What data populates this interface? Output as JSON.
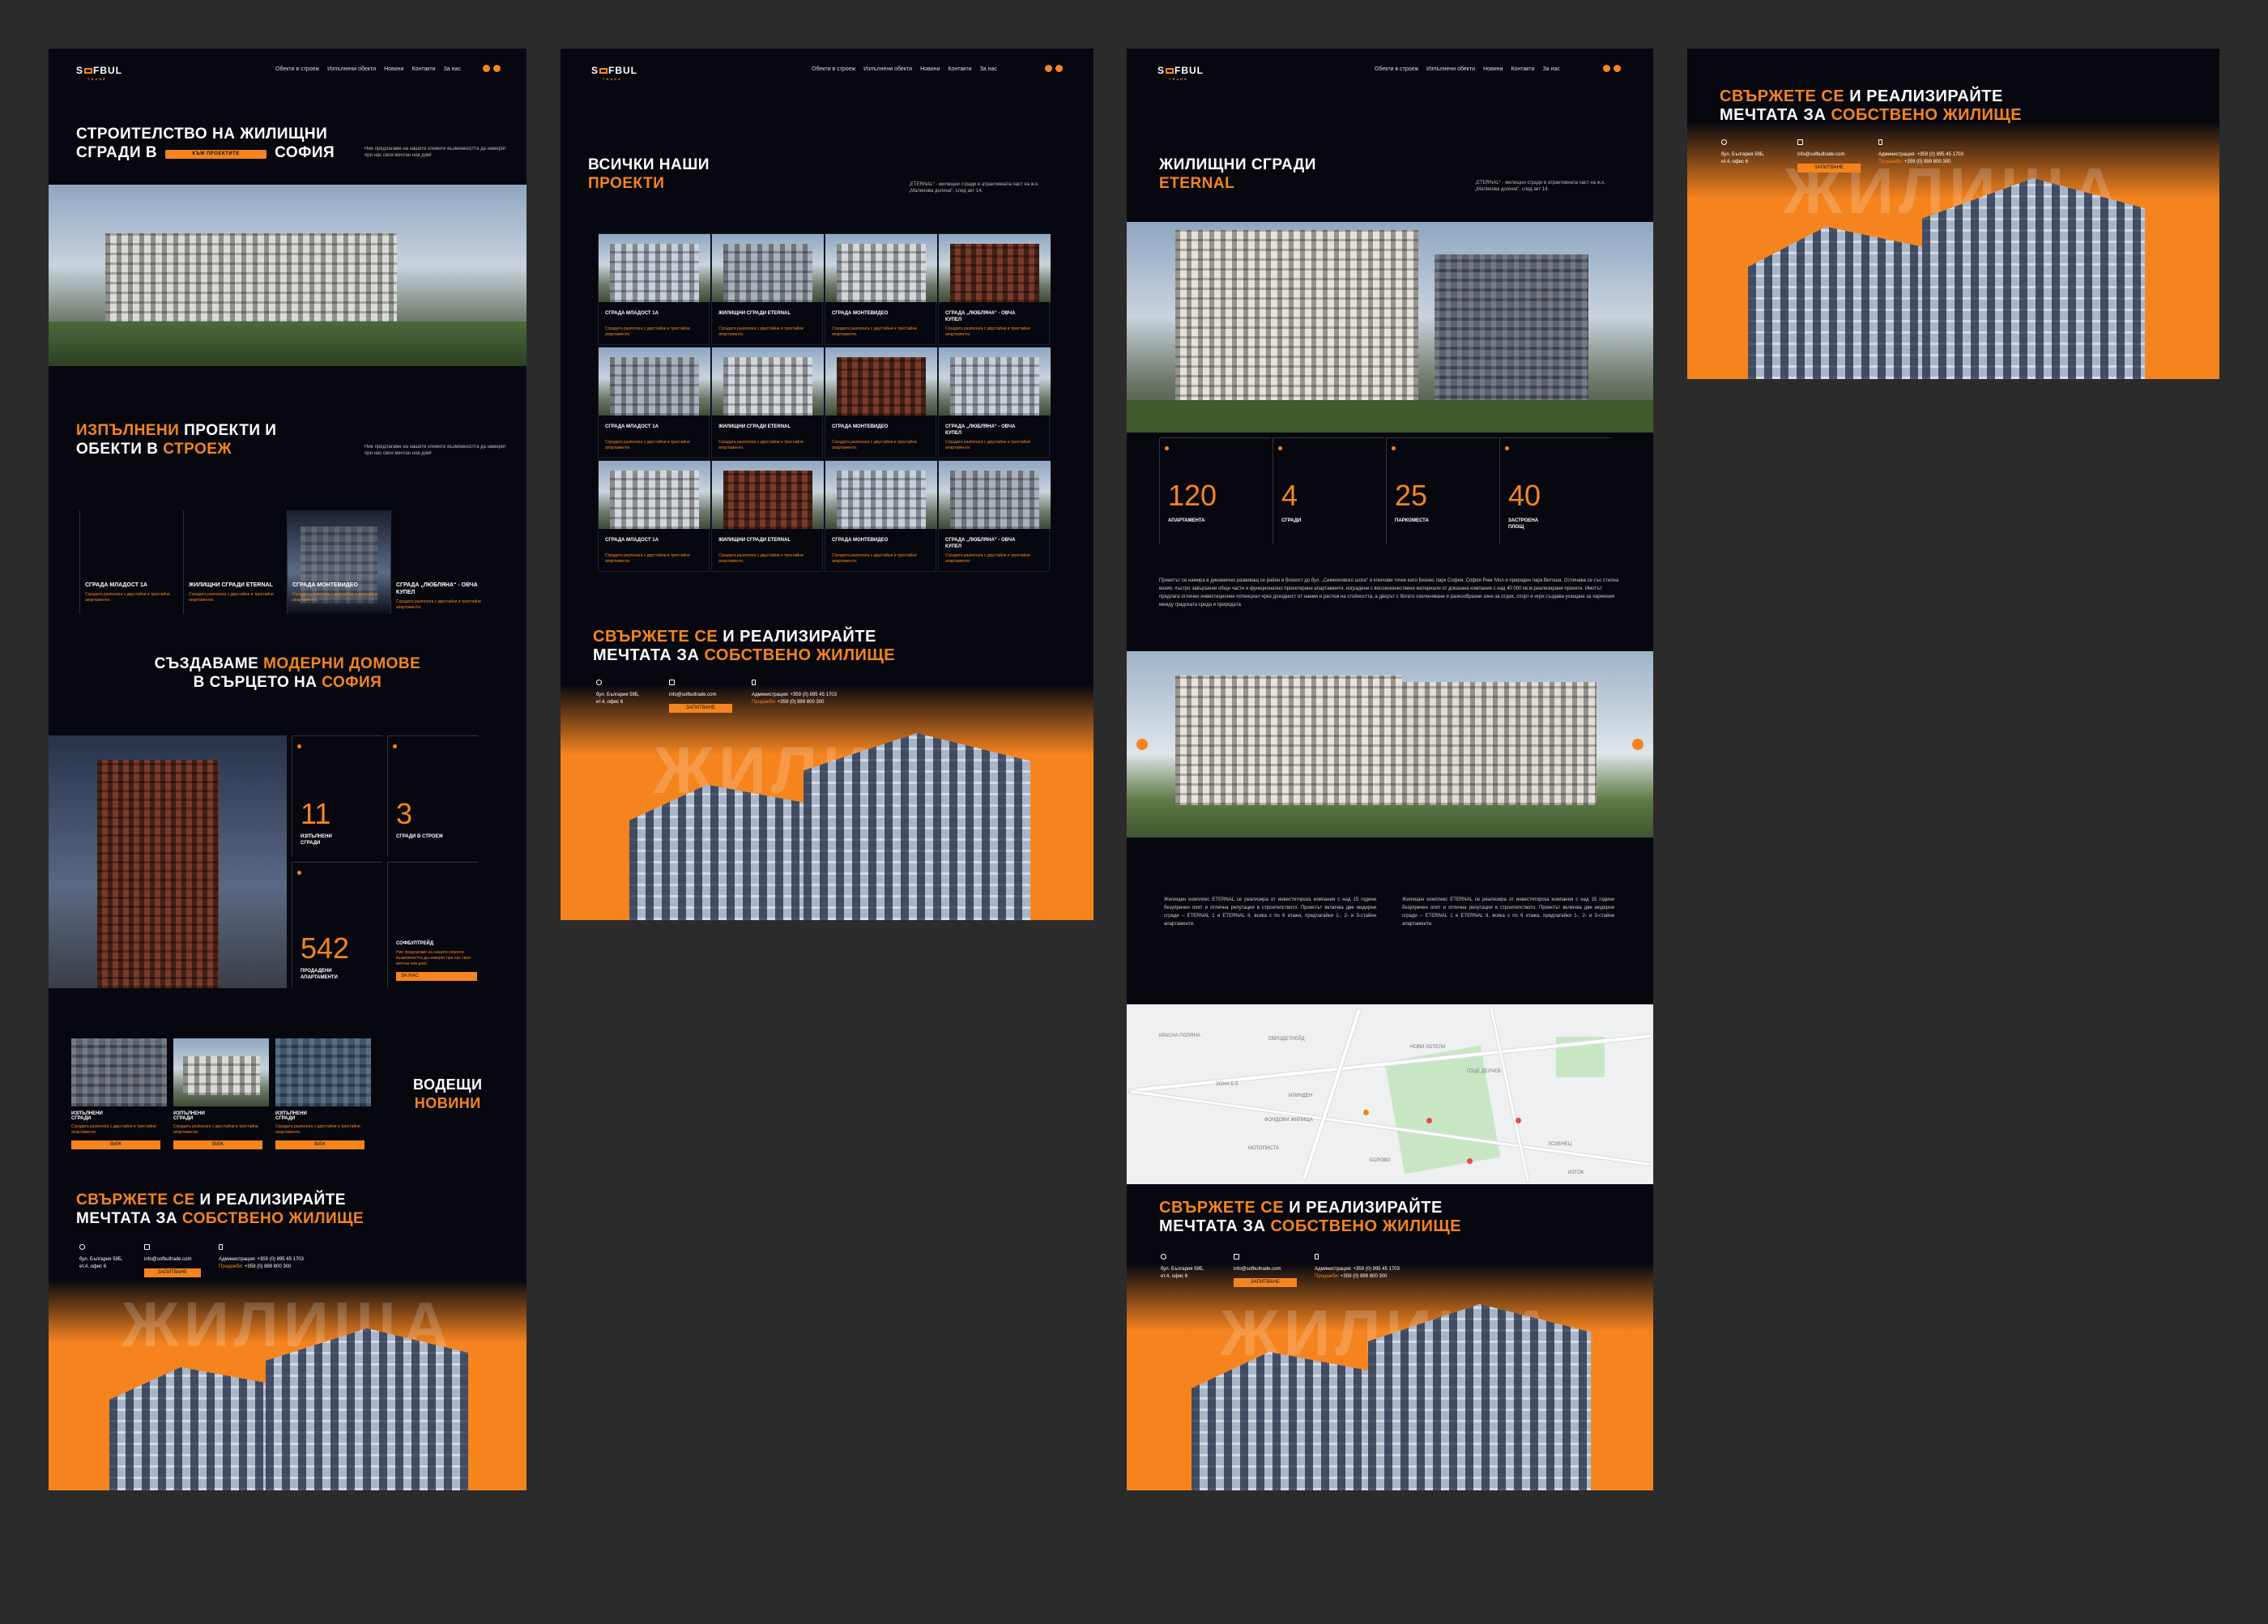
{
  "brand": {
    "name_a": "S",
    "name_b": "FBUL",
    "sub": "TRADE"
  },
  "nav": [
    "Обекти в строеж",
    "Изпълнени обекти",
    "Новини",
    "Контакти",
    "За нас"
  ],
  "home": {
    "hero_title_1": "СТРОИТЕЛСТВО НА ЖИЛИЩНИ",
    "hero_title_2a": "СГРАДИ В",
    "hero_title_2b": "СОФИЯ",
    "hero_btn": "КЪМ ПРОЕКТИТЕ",
    "hero_desc": "Ние предлагаме на нашите клиенти възможността да намерят при нас своя мечтан нов дом!",
    "sec2_a": "ИЗПЪЛНЕНИ",
    "sec2_b": "ПРОЕКТИ И",
    "sec2_c": "ОБЕКТИ В",
    "sec2_d": "СТРОЕЖ",
    "sec2_desc": "Ние предлагаме на нашите клиенти възможността да намерят при нас своя мечтан нов дом!",
    "cards": [
      {
        "title": "СГРАДА МЛАДОСТ 1А",
        "desc": "Сградата разполага с двустайни и тристайни апартаменти."
      },
      {
        "title": "ЖИЛИЩНИ СГРАДИ ETERNAL",
        "desc": "Сградата разполага с двустайни и тристайни апартаменти."
      },
      {
        "title": "СГРАДА МОНТЕВИДЕО",
        "desc": "Сградата разполага с двустайни и тристайни апартаменти."
      },
      {
        "title": "СГРАДА „ЛЮБЛЯНА“ - ОВЧА КУПЕЛ",
        "desc": "Сградата разполага с двустайни и тристайни апартаменти."
      }
    ],
    "sec3_a": "СЪЗДАВАМЕ",
    "sec3_b": "МОДЕРНИ ДОМОВЕ",
    "sec3_c": "В СЪРЦЕТО НА",
    "sec3_d": "СОФИЯ",
    "stats": [
      {
        "n": "11",
        "l": "ИЗПЪЛНЕНИ СГРАДИ"
      },
      {
        "n": "3",
        "l": "СГРАДИ В СТРОЕЖ"
      },
      {
        "n": "542",
        "l": "ПРОДАДЕНИ АПАРТАМЕНТИ"
      }
    ],
    "sofia_title": "СОФБУЛТРЕЙД",
    "sofia_desc": "Ние предлагаме на нашите клиенти възможността да намерят при нас своя мечтан нов дом!",
    "sofia_btn": "ЗА НАС",
    "news": [
      {
        "title": "ИЗПЪЛНЕНИ СГРАДИ",
        "desc": "Сградата разполага с двустайни и тристайни апартаменти.",
        "btn": "ВИЖ"
      },
      {
        "title": "ИЗПЪЛНЕНИ СГРАДИ",
        "desc": "Сградата разполага с двустайни и тристайни апартаменти.",
        "btn": "ВИЖ"
      },
      {
        "title": "ИЗПЪЛНЕНИ СГРАДИ",
        "desc": "Сградата разполага с двустайни и тристайни апартаменти.",
        "btn": "ВИЖ"
      }
    ],
    "news_a": "ВОДЕЩИ",
    "news_b": "НОВИНИ"
  },
  "projects": {
    "title_a": "ВСИЧКИ НАШИ",
    "title_b": "ПРОЕКТИ",
    "desc": "„ETERNAL“ - жилищни сгради в атрактивната част на ж.к. „Малинова долина“, след акт 14.",
    "grid": [
      {
        "title": "СГРАДА МЛАДОСТ 1А",
        "desc": "Сградата разполага с двустайни и тристайни апартаменти."
      },
      {
        "title": "ЖИЛИЩНИ СГРАДИ ETERNAL",
        "desc": "Сградата разполага с двустайни и тристайни апартаменти."
      },
      {
        "title": "СГРАДА МОНТЕВИДЕО",
        "desc": "Сградата разполага с двустайни и тристайни апартаменти."
      },
      {
        "title": "СГРАДА „ЛЮБЛЯНА“ - ОВЧА КУПЕЛ",
        "desc": "Сградата разполага с двустайни и тристайни апартаменти."
      },
      {
        "title": "СГРАДА МЛАДОСТ 1А",
        "desc": "Сградата разполага с двустайни и тристайни апартаменти."
      },
      {
        "title": "ЖИЛИЩНИ СГРАДИ ETERNAL",
        "desc": "Сградата разполага с двустайни и тристайни апартаменти."
      },
      {
        "title": "СГРАДА МОНТЕВИДЕО",
        "desc": "Сградата разполага с двустайни и тристайни апартаменти."
      },
      {
        "title": "СГРАДА „ЛЮБЛЯНА“ - ОВЧА КУПЕЛ",
        "desc": "Сградата разполага с двустайни и тристайни апартаменти."
      },
      {
        "title": "СГРАДА МЛАДОСТ 1А",
        "desc": "Сградата разполага с двустайни и тристайни апартаменти."
      },
      {
        "title": "ЖИЛИЩНИ СГРАДИ ETERNAL",
        "desc": "Сградата разполага с двустайни и тристайни апартаменти."
      },
      {
        "title": "СГРАДА МОНТЕВИДЕО",
        "desc": "Сградата разполага с двустайни и тристайни апартаменти."
      },
      {
        "title": "СГРАДА „ЛЮБЛЯНА“ - ОВЧА КУПЕЛ",
        "desc": "Сградата разполага с двустайни и тристайни апартаменти."
      }
    ]
  },
  "detail": {
    "title_a": "ЖИЛИЩНИ СГРАДИ",
    "title_b": "ETERNAL",
    "desc": "„ETERNAL“ - жилищни сгради в атрактивната част на ж.к. „Малинова долина“, след акт 14.",
    "stats": [
      {
        "n": "120",
        "l": "АПАРТАМЕНТА"
      },
      {
        "n": "4",
        "l": "СГРАДИ"
      },
      {
        "n": "25",
        "l": "ПАРКОМЕСТА"
      },
      {
        "n": "40",
        "l": "ЗАСТРОЕНА ПЛОЩ"
      }
    ],
    "para1": "Проектът се намира в динамично развиващ се район в близост до бул. „Симеоновско шосе“ и ключови точки като Бизнес парк София, София Ринг Мол и природен парк Витоша. Отличава се със стилна визия, пъстро завършени общи части и функционално проектирани апартаменти, изградени с висококачествени материали от доказана компания с над 40 000 кв.м реализирани проекти. Имотът предлага отлично инвестиционен потенциал чрез доходност от наеми и растеж на стойността, а дворът с богато озеленяване и разнообразни зони за отдих, спорт и игри създава усещане за хармония между градската среда и природата.",
    "para2": "Жилищен комплекс ETERNAL се реализира от инвеститорска компания с над 15 години безупречен опит и отлична репутация в строителството. Проектът включва две модерни сгради – ETERNAL 1 и ETERNAL II, всяка с по 6 етажа, предлагайки 1-, 2- и 3-стайни апартаменти.",
    "para3": "Жилищен комплекс ETERNAL се реализира от инвеститорска компания с над 15 години безупречен опит и отлична репутация в строителството. Проектът включва две модерни сгради – ETERNAL 1 и ETERNAL II, всяка с по 6 етажа, предлагайки 1-, 2- и 3-стайни апартаменти.",
    "map_labels": [
      "КРАСНА ПОЛЯНА",
      "ЕВРОДЕТРЕЙД",
      "ЗОНА Б-5",
      "ИЛИНДЕН",
      "ФОНДОВИ ЖИЛИЩА",
      "МОТОПИСТА",
      "БОРОВО",
      "НОВИ ХОТЕЛИ",
      "ГОЦЕ ДЕЛЧЕВ",
      "ИЗТОК",
      "ЛОЗЕНЕЦ"
    ]
  },
  "cta": {
    "a": "СВЪРЖЕТЕ СЕ",
    "b": "И РЕАЛИЗИРАЙТЕ",
    "c": "МЕЧТАТА ЗА",
    "d": "СОБСТВЕНО ЖИЛИЩЕ",
    "addr1": "бул. България 59Б,",
    "addr2": "ет.4, офис 6",
    "email": "info@sofbultrade.com",
    "btn": "ЗАПИТВАНЕ",
    "admin": "Администрация: +359 (0) 895 45 1703",
    "sales_label": "Продажби:",
    "sales": "+359 (0) 899 800 300",
    "bg_word": "ЖИЛИЩА"
  },
  "colors": {
    "accent": "#f5841f",
    "bg": "#07080f",
    "outer": "#2b2b2b"
  }
}
